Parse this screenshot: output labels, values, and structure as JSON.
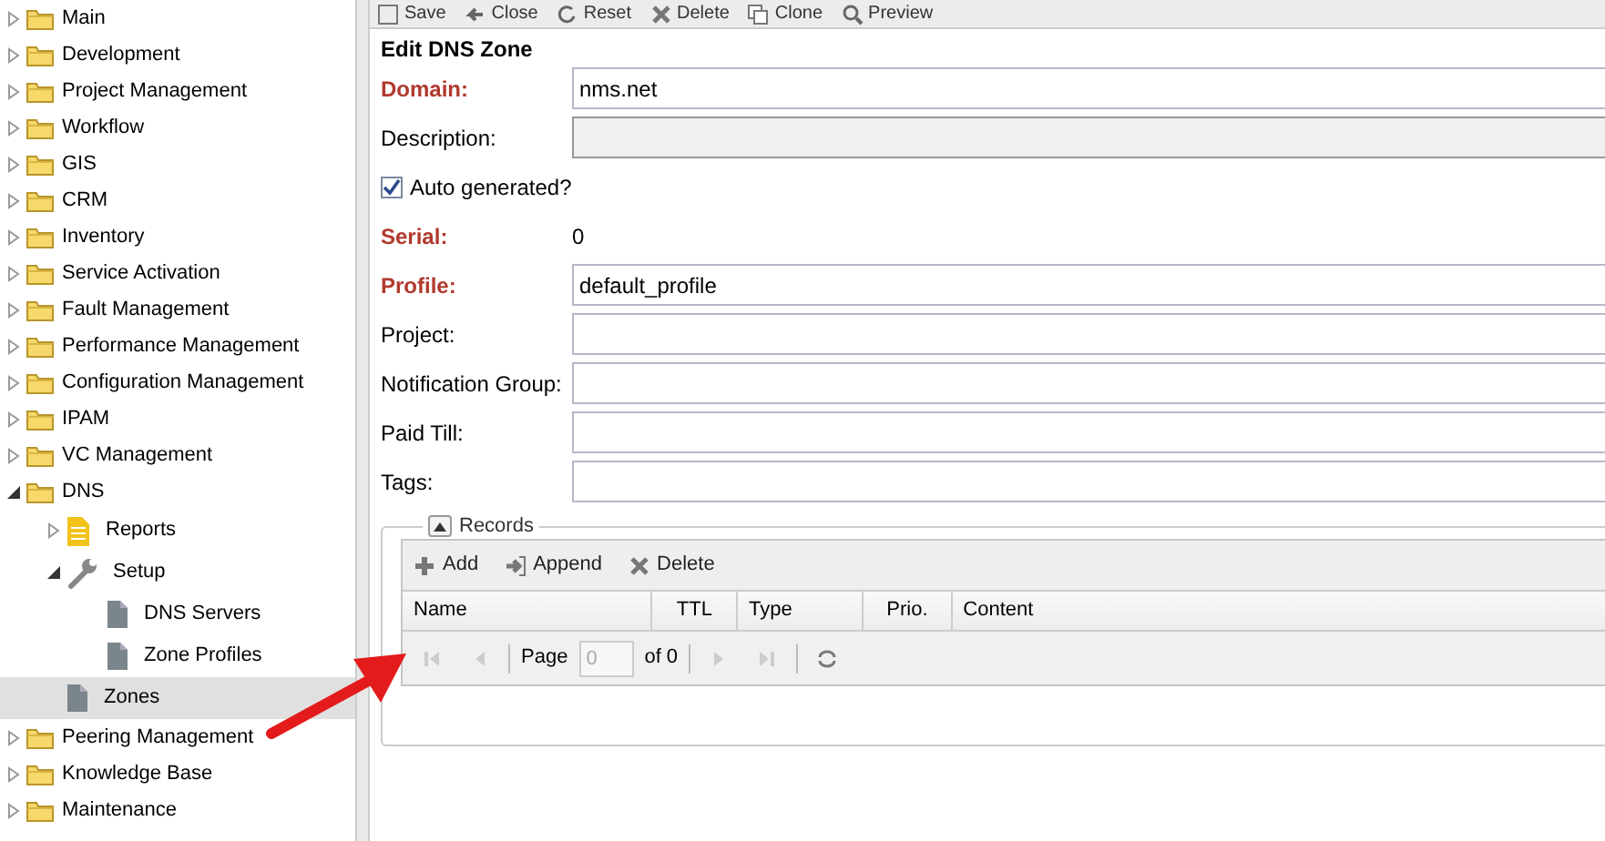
{
  "sidebar": {
    "items": [
      {
        "label": "Main",
        "kind": "folder",
        "expanded": false,
        "selected": false
      },
      {
        "label": "Development",
        "kind": "folder",
        "expanded": false,
        "selected": false
      },
      {
        "label": "Project Management",
        "kind": "folder",
        "expanded": false,
        "selected": false
      },
      {
        "label": "Workflow",
        "kind": "folder",
        "expanded": false,
        "selected": false
      },
      {
        "label": "GIS",
        "kind": "folder",
        "expanded": false,
        "selected": false
      },
      {
        "label": "CRM",
        "kind": "folder",
        "expanded": false,
        "selected": false
      },
      {
        "label": "Inventory",
        "kind": "folder",
        "expanded": false,
        "selected": false
      },
      {
        "label": "Service Activation",
        "kind": "folder",
        "expanded": false,
        "selected": false
      },
      {
        "label": "Fault Management",
        "kind": "folder",
        "expanded": false,
        "selected": false
      },
      {
        "label": "Performance Management",
        "kind": "folder",
        "expanded": false,
        "selected": false
      },
      {
        "label": "Configuration Management",
        "kind": "folder",
        "expanded": false,
        "selected": false
      },
      {
        "label": "IPAM",
        "kind": "folder",
        "expanded": false,
        "selected": false
      },
      {
        "label": "VC Management",
        "kind": "folder",
        "expanded": false,
        "selected": false
      },
      {
        "label": "DNS",
        "kind": "folder",
        "expanded": true,
        "selected": false,
        "children": [
          {
            "label": "Reports",
            "kind": "report",
            "expanded": false,
            "selected": false
          },
          {
            "label": "Setup",
            "kind": "tool",
            "expanded": true,
            "selected": false,
            "children": [
              {
                "label": "DNS Servers",
                "kind": "page",
                "selected": false
              },
              {
                "label": "Zone Profiles",
                "kind": "page",
                "selected": false
              }
            ]
          },
          {
            "label": "Zones",
            "kind": "page",
            "selected": true
          }
        ]
      },
      {
        "label": "Peering Management",
        "kind": "folder",
        "expanded": false,
        "selected": false
      },
      {
        "label": "Knowledge Base",
        "kind": "folder",
        "expanded": false,
        "selected": false
      },
      {
        "label": "Maintenance",
        "kind": "folder",
        "expanded": false,
        "selected": false
      }
    ]
  },
  "toolbar": [
    {
      "label": "Save"
    },
    {
      "label": "Close"
    },
    {
      "label": "Reset"
    },
    {
      "label": "Delete"
    },
    {
      "label": "Clone"
    },
    {
      "label": "Preview"
    }
  ],
  "form": {
    "title": "Edit DNS Zone",
    "fields": [
      {
        "kind": "text",
        "label": "Domain:",
        "required": true,
        "value": "nms.net",
        "focused": false
      },
      {
        "kind": "text",
        "label": "Description:",
        "required": false,
        "focused": true
      },
      {
        "kind": "checkbox",
        "label": "Auto generated?",
        "checked": true
      },
      {
        "kind": "display",
        "label": "Serial:",
        "required": true,
        "value": "0"
      },
      {
        "kind": "text",
        "label": "Profile:",
        "required": true,
        "value": "default_profile",
        "focused": false
      },
      {
        "kind": "text",
        "label": "Project:",
        "required": false,
        "focused": false
      },
      {
        "kind": "text",
        "label": "Notification Group:",
        "required": false,
        "focused": false
      },
      {
        "kind": "text",
        "label": "Paid Till:",
        "required": false,
        "focused": false
      },
      {
        "kind": "text",
        "label": "Tags:",
        "required": false,
        "focused": false
      }
    ]
  },
  "records": {
    "title": "Records",
    "expanded": true,
    "buttons": [
      {
        "label": "Add"
      },
      {
        "label": "Append"
      },
      {
        "label": "Delete"
      }
    ],
    "columns": [
      "Name",
      "TTL",
      "Type",
      "Prio.",
      "Content"
    ],
    "pager": {
      "page_label": "Page",
      "page_value": "0",
      "of_label": "of 0"
    }
  }
}
